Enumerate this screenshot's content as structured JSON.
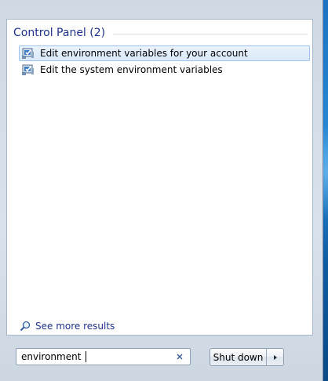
{
  "results": {
    "group_title": "Control Panel (2)",
    "items": [
      {
        "label": "Edit environment variables for your account",
        "icon": "control-panel-system-icon",
        "selected": true
      },
      {
        "label": "Edit the system environment variables",
        "icon": "control-panel-system-icon",
        "selected": false
      }
    ]
  },
  "see_more": {
    "label": "See more results",
    "icon": "magnifier-icon"
  },
  "search": {
    "value": "environment",
    "clear_icon": "clear-x-icon"
  },
  "power": {
    "shutdown_label": "Shut down",
    "options_icon": "triangle-right-icon"
  },
  "colors": {
    "accent_text": "#1e3287",
    "selection_border": "#9ec4ee"
  }
}
